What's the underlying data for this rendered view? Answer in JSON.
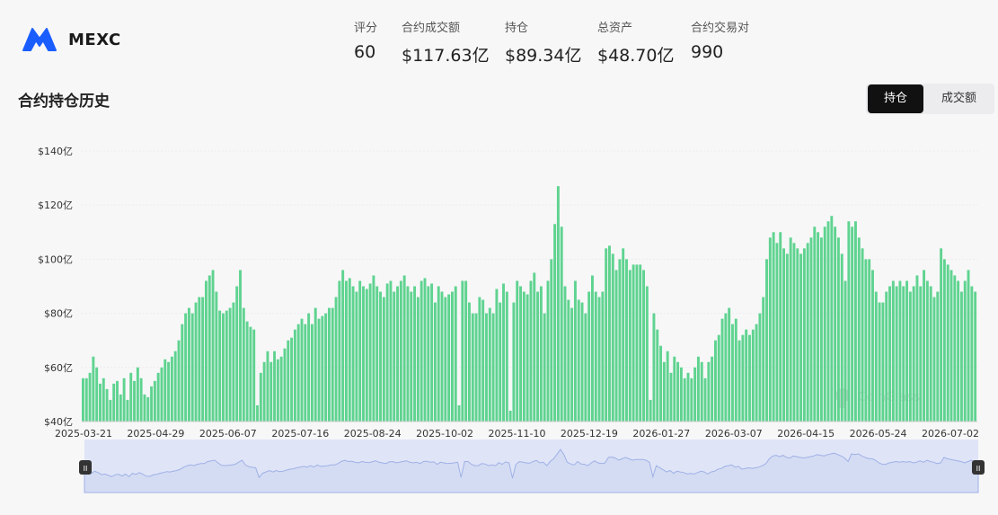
{
  "header": {
    "brand": "MEXC",
    "stats": [
      {
        "label": "评分",
        "value": "60"
      },
      {
        "label": "合约成交额",
        "value": "$117.63亿"
      },
      {
        "label": "持仓",
        "value": "$89.34亿"
      },
      {
        "label": "总资产",
        "value": "$48.70亿"
      },
      {
        "label": "合约交易对",
        "value": "990"
      }
    ]
  },
  "section": {
    "title": "合约持仓历史",
    "tabs": [
      {
        "label": "持仓",
        "active": true
      },
      {
        "label": "成交额",
        "active": false
      }
    ]
  },
  "watermark": "CoinGlass",
  "colors": {
    "bar": "#5fd390",
    "brand": "#1a5dff",
    "navigator_fill": "#dfe5f7",
    "navigator_line": "#9fb0e6"
  },
  "chart_data": {
    "type": "bar",
    "title": "",
    "xlabel": "",
    "ylabel": "",
    "ylim": [
      40,
      140
    ],
    "yticks": [
      40,
      60,
      80,
      100,
      120,
      140
    ],
    "ytick_labels": [
      "$40亿",
      "$60亿",
      "$80亿",
      "$100亿",
      "$120亿",
      "$140亿"
    ],
    "xtick_labels": [
      "2025-03-21",
      "2025-04-29",
      "2025-06-07",
      "2025-07-16",
      "2025-08-24",
      "2025-10-02",
      "2025-11-10",
      "2025-12-19",
      "2026-01-27",
      "2026-03-07",
      "2026-04-15",
      "2026-05-24",
      "2026-07-02"
    ],
    "interval_days": 3,
    "unit": "$亿",
    "values": [
      56,
      56,
      58,
      64,
      60,
      54,
      56,
      52,
      48,
      54,
      55,
      50,
      56,
      48,
      58,
      55,
      60,
      56,
      50,
      49,
      53,
      55,
      58,
      60,
      63,
      62,
      64,
      66,
      70,
      76,
      80,
      82,
      80,
      84,
      86,
      86,
      92,
      94,
      96,
      88,
      81,
      80,
      81,
      82,
      84,
      90,
      96,
      82,
      77,
      75,
      74,
      46,
      58,
      62,
      66,
      62,
      66,
      63,
      64,
      67,
      70,
      71,
      74,
      76,
      78,
      76,
      80,
      76,
      82,
      78,
      79,
      80,
      82,
      82,
      86,
      92,
      96,
      92,
      93,
      90,
      88,
      92,
      90,
      89,
      91,
      94,
      90,
      88,
      86,
      91,
      92,
      88,
      90,
      92,
      94,
      90,
      88,
      90,
      86,
      92,
      93,
      90,
      91,
      84,
      90,
      88,
      86,
      87,
      88,
      90,
      46,
      92,
      92,
      84,
      80,
      80,
      86,
      85,
      80,
      82,
      80,
      89,
      84,
      91,
      88,
      44,
      84,
      92,
      90,
      88,
      87,
      92,
      95,
      88,
      90,
      80,
      92,
      100,
      113,
      127,
      112,
      90,
      85,
      82,
      92,
      85,
      84,
      80,
      88,
      94,
      88,
      86,
      88,
      104,
      105,
      102,
      96,
      100,
      104,
      100,
      96,
      98,
      98,
      98,
      96,
      90,
      48,
      80,
      74,
      68,
      62,
      66,
      58,
      64,
      62,
      60,
      56,
      58,
      56,
      60,
      64,
      62,
      56,
      62,
      64,
      70,
      72,
      78,
      80,
      82,
      76,
      78,
      70,
      72,
      74,
      72,
      74,
      76,
      80,
      86,
      100,
      108,
      110,
      106,
      110,
      104,
      102,
      108,
      106,
      104,
      102,
      104,
      106,
      108,
      112,
      110,
      108,
      112,
      114,
      116,
      112,
      108,
      102,
      92,
      114,
      112,
      114,
      108,
      104,
      100,
      100,
      96,
      88,
      84,
      84,
      88,
      90,
      92,
      90,
      92,
      90,
      92,
      88,
      90,
      94,
      90,
      96,
      92,
      90,
      86,
      88,
      104,
      100,
      98,
      96,
      94,
      92,
      88,
      92,
      96,
      90,
      88
    ]
  },
  "navigator": {
    "handle_glyph": "II"
  }
}
